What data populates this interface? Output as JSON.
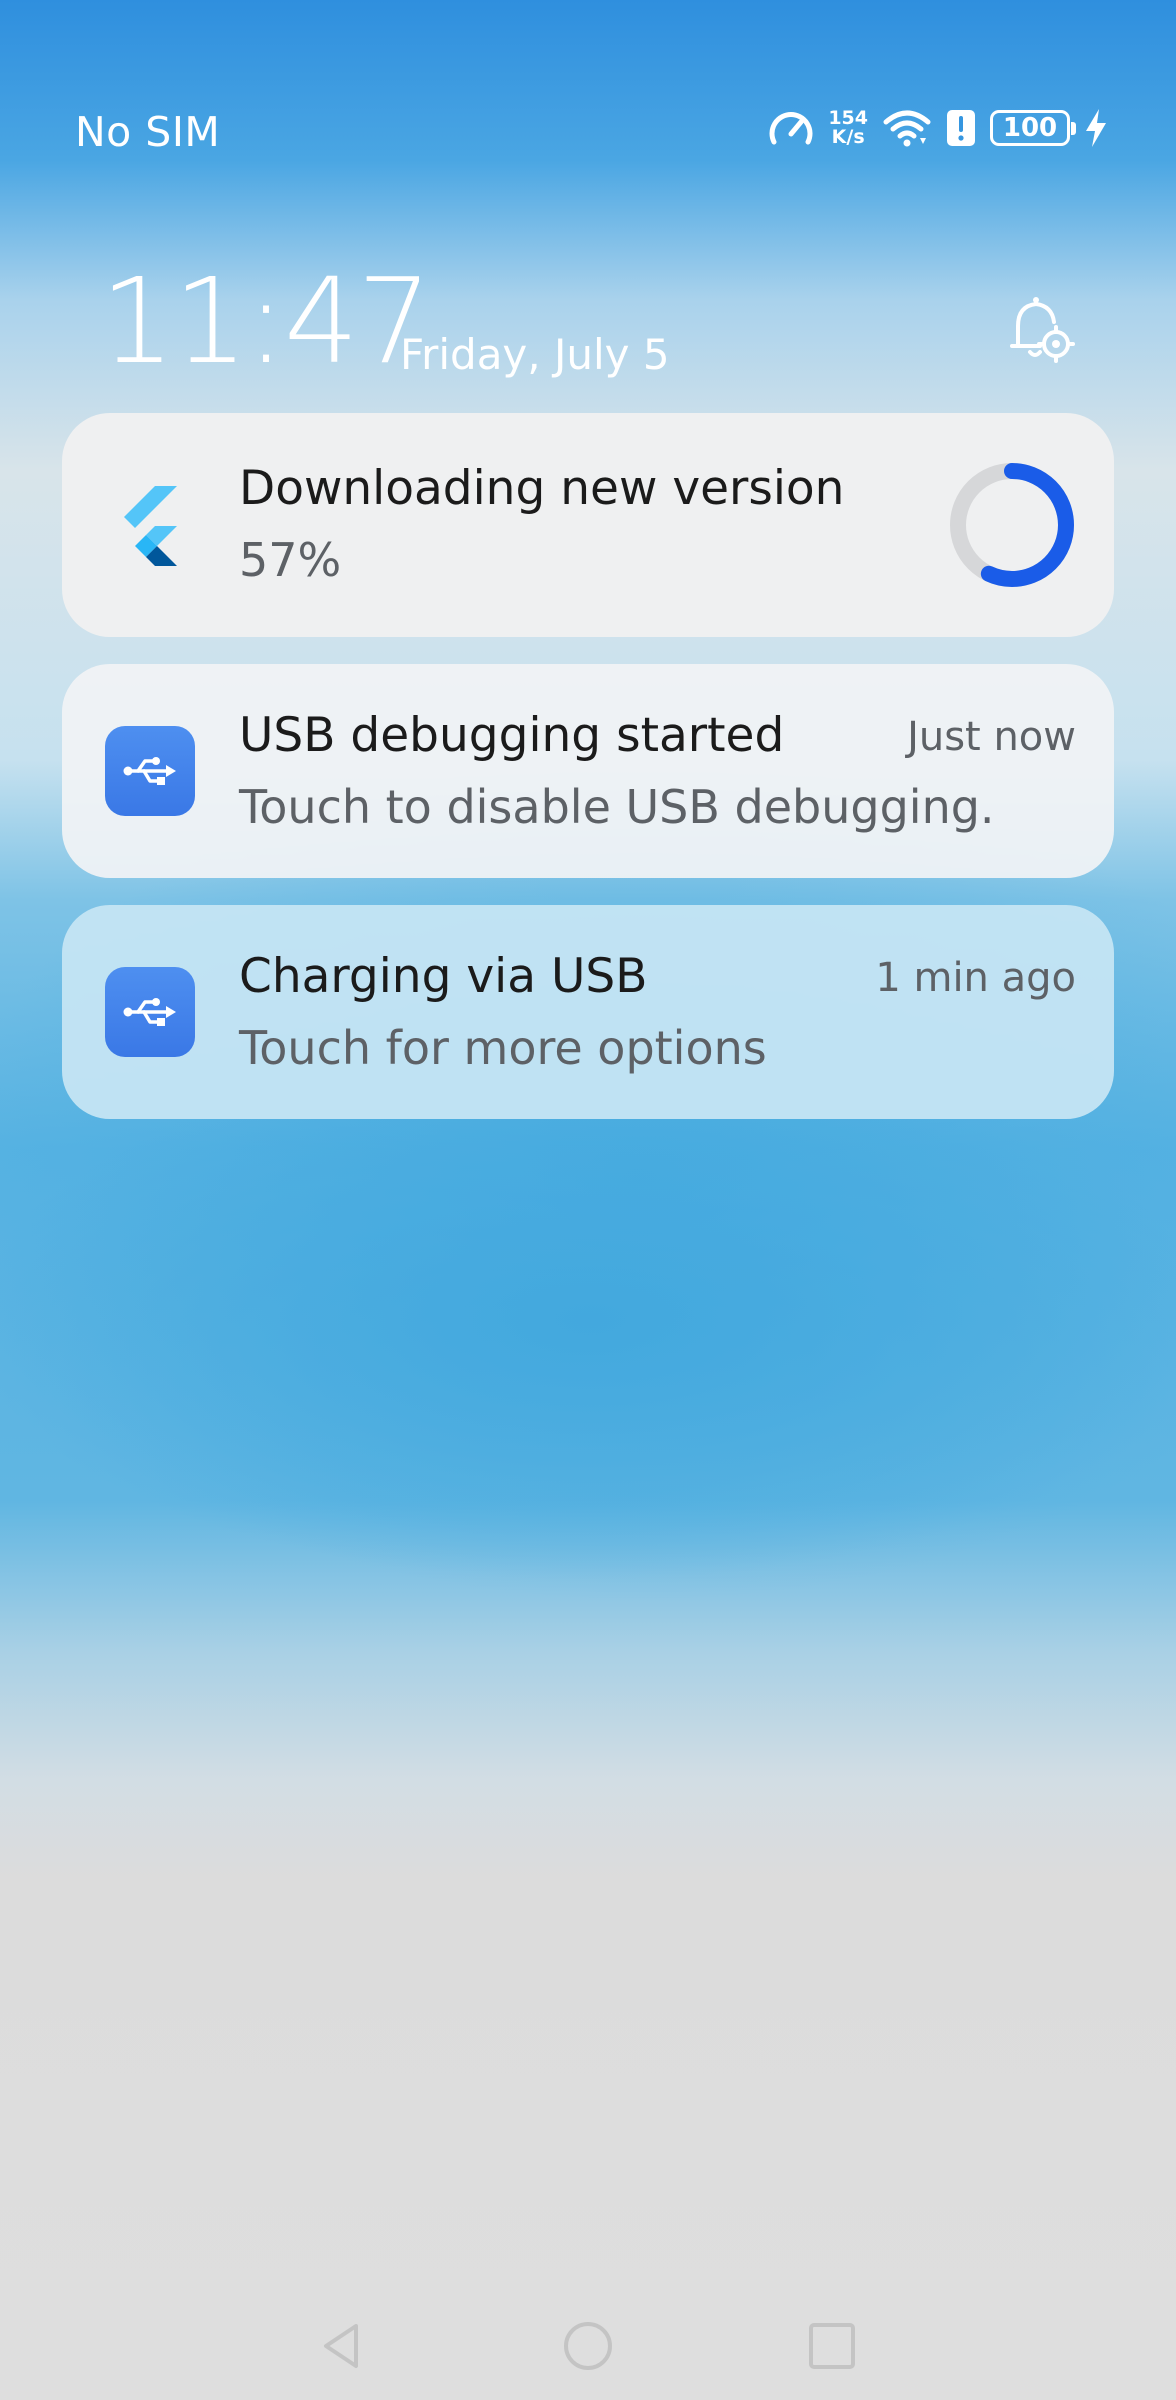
{
  "status_bar": {
    "carrier": "No SIM",
    "net_speed_value": "154",
    "net_speed_unit": "K/s",
    "battery_level": "100",
    "icons": [
      "speedometer-icon",
      "wifi-icon",
      "alert-icon",
      "battery-icon",
      "charging-bolt-icon"
    ]
  },
  "header": {
    "time": "11:47",
    "date": "Friday, July 5",
    "settings_icon": "notification-settings-icon"
  },
  "notifications": [
    {
      "app_icon": "flutter-logo-icon",
      "title": "Downloading new version",
      "subtitle": "57%",
      "progress": 0.57,
      "progress_color": "#1a5ce8"
    },
    {
      "app_icon": "usb-icon",
      "title": "USB debugging started",
      "subtitle": "Touch to disable USB debugging.",
      "time": "Just now"
    },
    {
      "app_icon": "usb-icon",
      "title": "Charging via USB",
      "subtitle": "Touch for more options",
      "time": "1 min ago"
    }
  ],
  "nav_bar": {
    "buttons": [
      "back-icon",
      "home-icon",
      "recents-icon"
    ]
  },
  "colors": {
    "usb_badge": "#3f7fe8",
    "progress_track": "#d6d7d9",
    "progress_fill": "#1a5ce8"
  }
}
